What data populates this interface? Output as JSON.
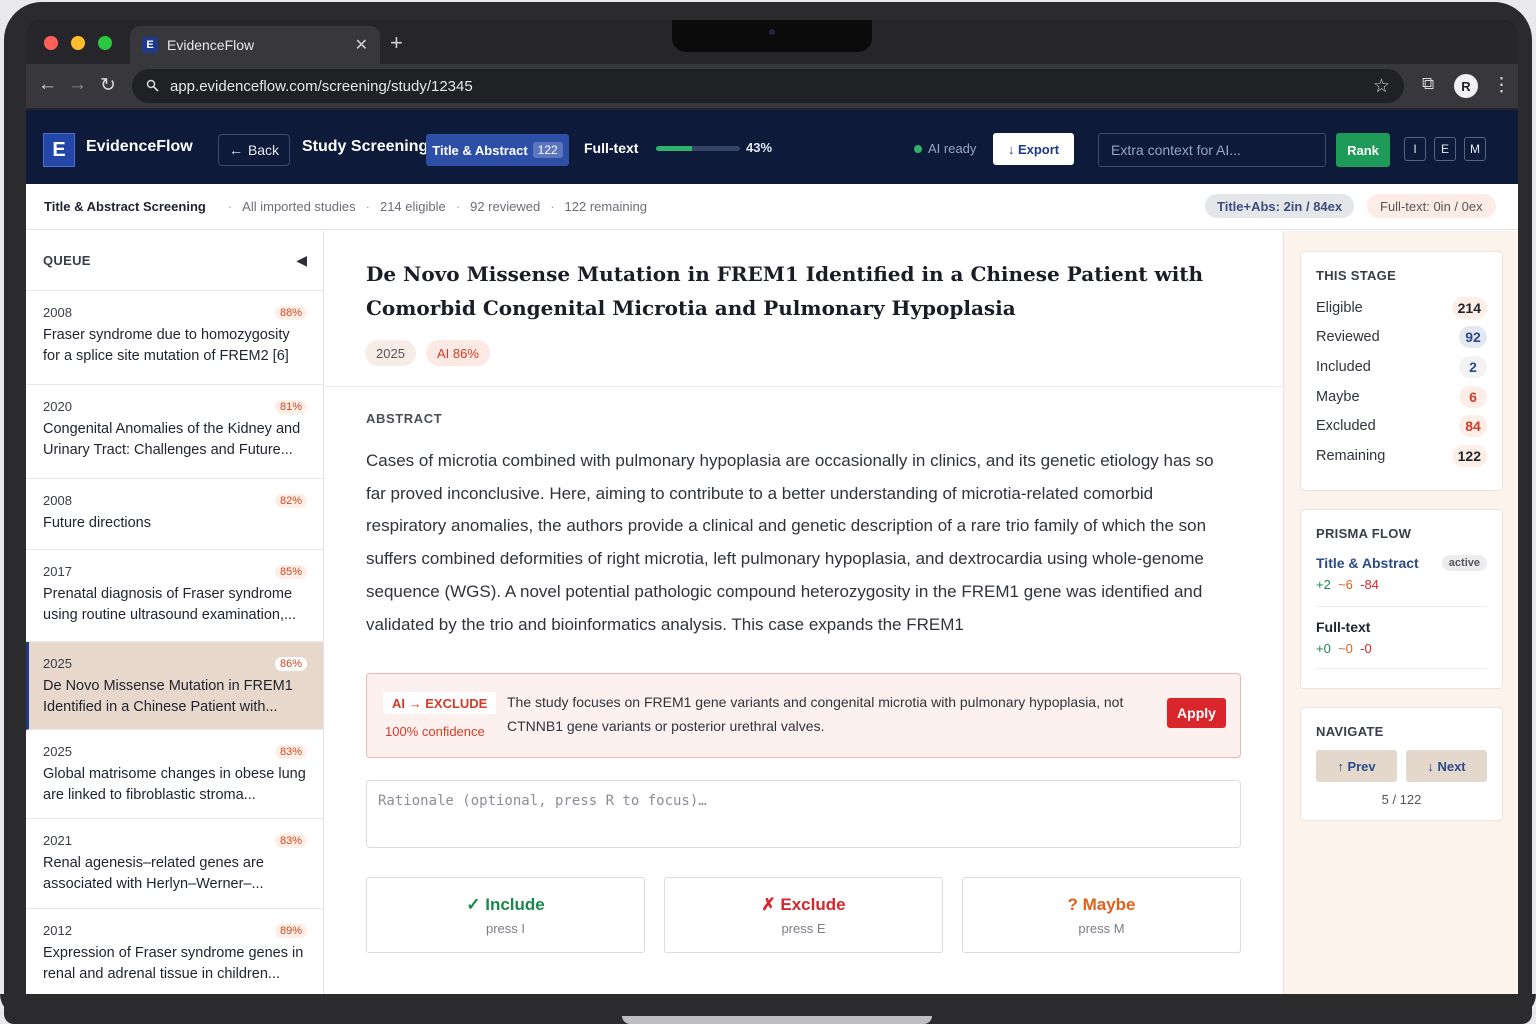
{
  "browser": {
    "tab_title": "EvidenceFlow",
    "favicon": "E",
    "url": "app.evidenceflow.com/screening/study/12345",
    "profile_initial": "R"
  },
  "topbar": {
    "logo_letter": "E",
    "brand": "EvidenceFlow",
    "back_label": "Back",
    "page_heading": "Study Screening",
    "stage_tab_label": "Title & Abstract",
    "stage_tab_count": "122",
    "fulltext_label": "Full-text",
    "progress_pct_label": "43%",
    "progress_value": 0.43,
    "ai_status": "AI ready",
    "export_label": "↓ Export",
    "context_placeholder": "Extra context for AI...",
    "rank_label": "Rank",
    "keys": [
      "I",
      "E",
      "M"
    ]
  },
  "subbar": {
    "title": "Title & Abstract Screening",
    "scope": "All imported studies",
    "eligible": "214 eligible",
    "reviewed": "92 reviewed",
    "remaining": "122 remaining",
    "pill_abs": "Title+Abs: 2in / 84ex",
    "pill_ft": "Full-text: 0in / 0ex"
  },
  "queue": {
    "label": "QUEUE",
    "items": [
      {
        "year": "2008",
        "score": "88%",
        "title": "Fraser syndrome due to homozygosity for a splice site mutation of FREM2 [6]"
      },
      {
        "year": "2020",
        "score": "81%",
        "title": "Congenital Anomalies of the Kidney and Urinary Tract: Challenges and Future..."
      },
      {
        "year": "2008",
        "score": "82%",
        "title": "Future directions"
      },
      {
        "year": "2017",
        "score": "85%",
        "title": "Prenatal diagnosis of Fraser syndrome using routine ultrasound examination,..."
      },
      {
        "year": "2025",
        "score": "86%",
        "title": "De Novo Missense Mutation in FREM1 Identified in a Chinese Patient with..."
      },
      {
        "year": "2025",
        "score": "83%",
        "title": "Global matrisome changes in obese lung are linked to fibroblastic stroma..."
      },
      {
        "year": "2021",
        "score": "83%",
        "title": "Renal agenesis–related genes are associated with Herlyn–Werner–..."
      },
      {
        "year": "2012",
        "score": "89%",
        "title": "Expression of Fraser syndrome genes in renal and adrenal tissue in children..."
      }
    ]
  },
  "study": {
    "title": "De Novo Missense Mutation in FREM1 Identified in a Chinese Patient with Comorbid Congenital Microtia and Pulmonary Hypoplasia",
    "year": "2025",
    "ai_score": "AI 86%",
    "abstract_label": "ABSTRACT",
    "abstract": "Cases of microtia combined with pulmonary hypoplasia are occasionally in clinics, and its genetic etiology has so far proved inconclusive. Here, aiming to contribute to a better understanding of microtia-related comorbid respiratory anomalies, the authors provide a clinical and genetic description of a rare trio family of which the son suffers combined deformities of right microtia, left pulmonary hypoplasia, and dextrocardia using whole-genome sequence (WGS). A novel potential pathologic compound heterozygosity in the FREM1 gene was identified and validated by the trio and bioinformatics analysis. This case expands the FREM1"
  },
  "ai_recommendation": {
    "tag": "AI → EXCLUDE",
    "confidence": "100% confidence",
    "reason": "The study focuses on FREM1 gene variants and congenital microtia with pulmonary hypoplasia, not CTNNB1 gene variants or posterior urethral valves.",
    "apply_label": "Apply"
  },
  "rationale_placeholder": "Rationale (optional, press R to focus)…",
  "decisions": {
    "include": {
      "label": "✓ Include",
      "key": "press I",
      "color": "#1a8a4a"
    },
    "exclude": {
      "label": "✗ Exclude",
      "key": "press E",
      "color": "#d9262b"
    },
    "maybe": {
      "label": "? Maybe",
      "key": "press M",
      "color": "#e0621a"
    }
  },
  "this_stage": {
    "title": "THIS STAGE",
    "rows": [
      {
        "label": "Eligible",
        "value": "214"
      },
      {
        "label": "Reviewed",
        "value": "92"
      },
      {
        "label": "Included",
        "value": "2"
      },
      {
        "label": "Maybe",
        "value": "6"
      },
      {
        "label": "Excluded",
        "value": "84"
      },
      {
        "label": "Remaining",
        "value": "122"
      }
    ]
  },
  "prisma": {
    "title": "PRISMA FLOW",
    "stage1_label": "Title & Abstract",
    "stage1_badge": "active",
    "stage1_in": "+2",
    "stage1_maybe": "~6",
    "stage1_out": "-84",
    "stage2_label": "Full-text",
    "stage2_in": "+0",
    "stage2_maybe": "~0",
    "stage2_out": "-0"
  },
  "navigate": {
    "title": "NAVIGATE",
    "prev_label": "↑ Prev",
    "next_label": "↓ Next",
    "position": "5 / 122"
  }
}
